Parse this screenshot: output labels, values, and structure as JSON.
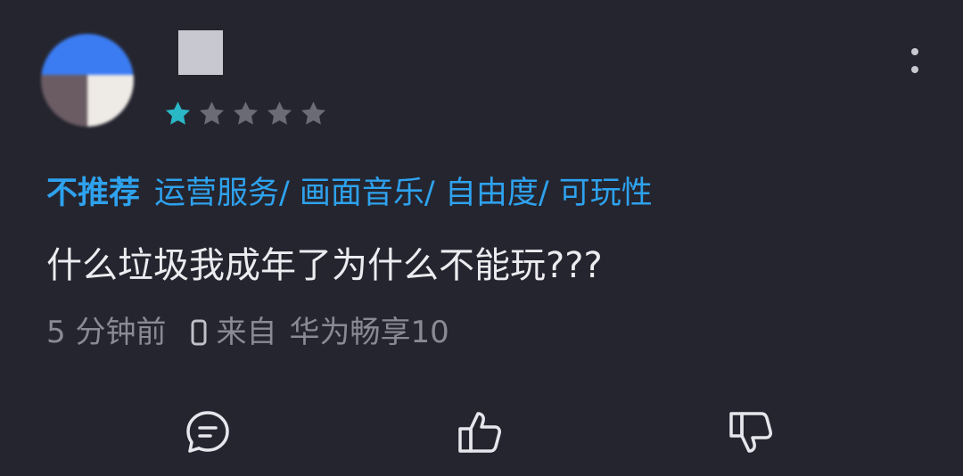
{
  "rating": {
    "value": 1,
    "max": 5
  },
  "colors": {
    "star_filled": "#2ab7c6",
    "star_empty": "#6b6b76",
    "tag": "#2ea2ee",
    "text": "#ececf0",
    "meta": "#8a8a94",
    "background": "#25252f"
  },
  "review": {
    "verdict": "不推荐",
    "tags": "运营服务/ 画面音乐/ 自由度/ 可玩性",
    "text": "什么垃圾我成年了为什么不能玩???",
    "time": "5 分钟前",
    "source_label": "来自",
    "device": "华为畅享10"
  },
  "icons": {
    "more": "more-vertical-icon",
    "phone": "phone-icon",
    "reply": "comment-icon",
    "like": "thumbs-up-icon",
    "dislike": "thumbs-down-icon"
  }
}
